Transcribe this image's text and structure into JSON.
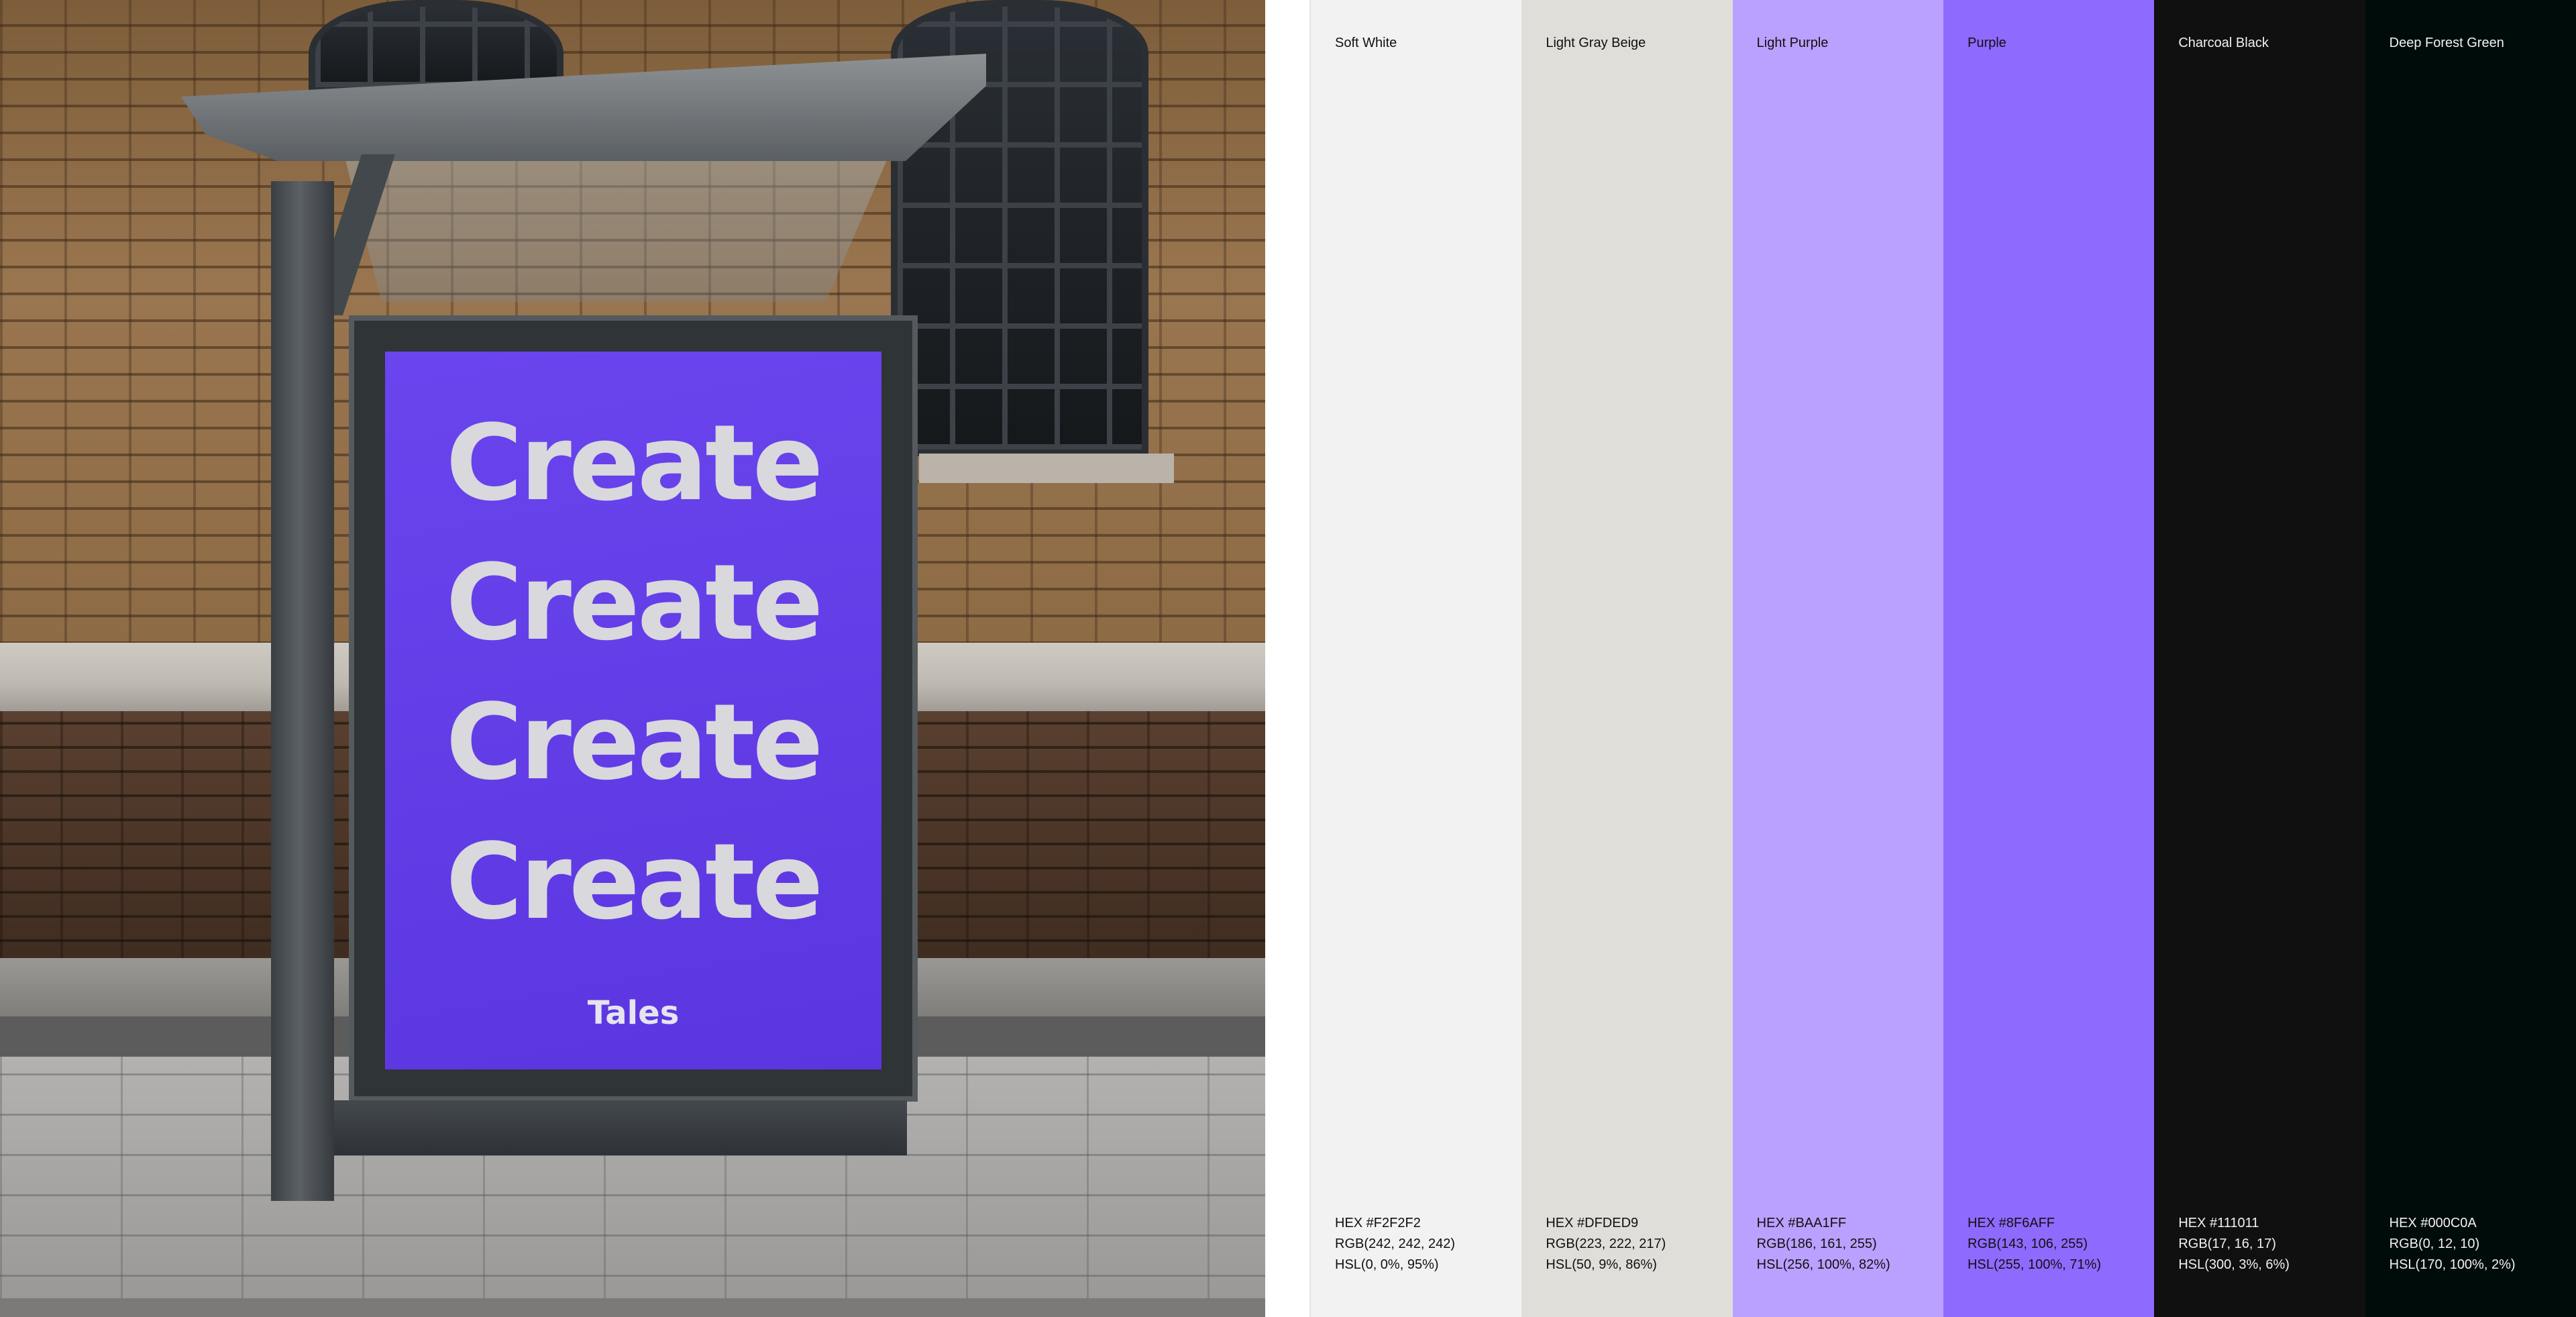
{
  "poster": {
    "words": [
      "Create",
      "Create",
      "Create",
      "Create"
    ],
    "logo": "Tales"
  },
  "palette": [
    {
      "name": "Soft White",
      "hex": "HEX #F2F2F2",
      "rgb": "RGB(242, 242, 242)",
      "hsl": "HSL(0, 0%, 95%)",
      "color": "#F2F2F2",
      "text_color": "#111011"
    },
    {
      "name": "Light Gray Beige",
      "hex": "HEX #DFDED9",
      "rgb": "RGB(223, 222, 217)",
      "hsl": "HSL(50, 9%, 86%)",
      "color": "#DFDED9",
      "text_color": "#111011"
    },
    {
      "name": "Light Purple",
      "hex": "HEX #BAA1FF",
      "rgb": "RGB(186, 161, 255)",
      "hsl": "HSL(256, 100%, 82%)",
      "color": "#BAA1FF",
      "text_color": "#111011"
    },
    {
      "name": "Purple",
      "hex": "HEX #8F6AFF",
      "rgb": "RGB(143, 106, 255)",
      "hsl": "HSL(255, 100%, 71%)",
      "color": "#8F6AFF",
      "text_color": "#111011"
    },
    {
      "name": "Charcoal Black",
      "hex": "HEX #111011",
      "rgb": "RGB(17, 16, 17)",
      "hsl": "HSL(300, 3%, 6%)",
      "color": "#111011",
      "text_color": "#F2F2F2"
    },
    {
      "name": "Deep Forest Green",
      "hex": "HEX #000C0A",
      "rgb": "RGB(0, 12, 10)",
      "hsl": "HSL(170, 100%, 2%)",
      "color": "#000C0A",
      "text_color": "#F2F2F2"
    }
  ]
}
